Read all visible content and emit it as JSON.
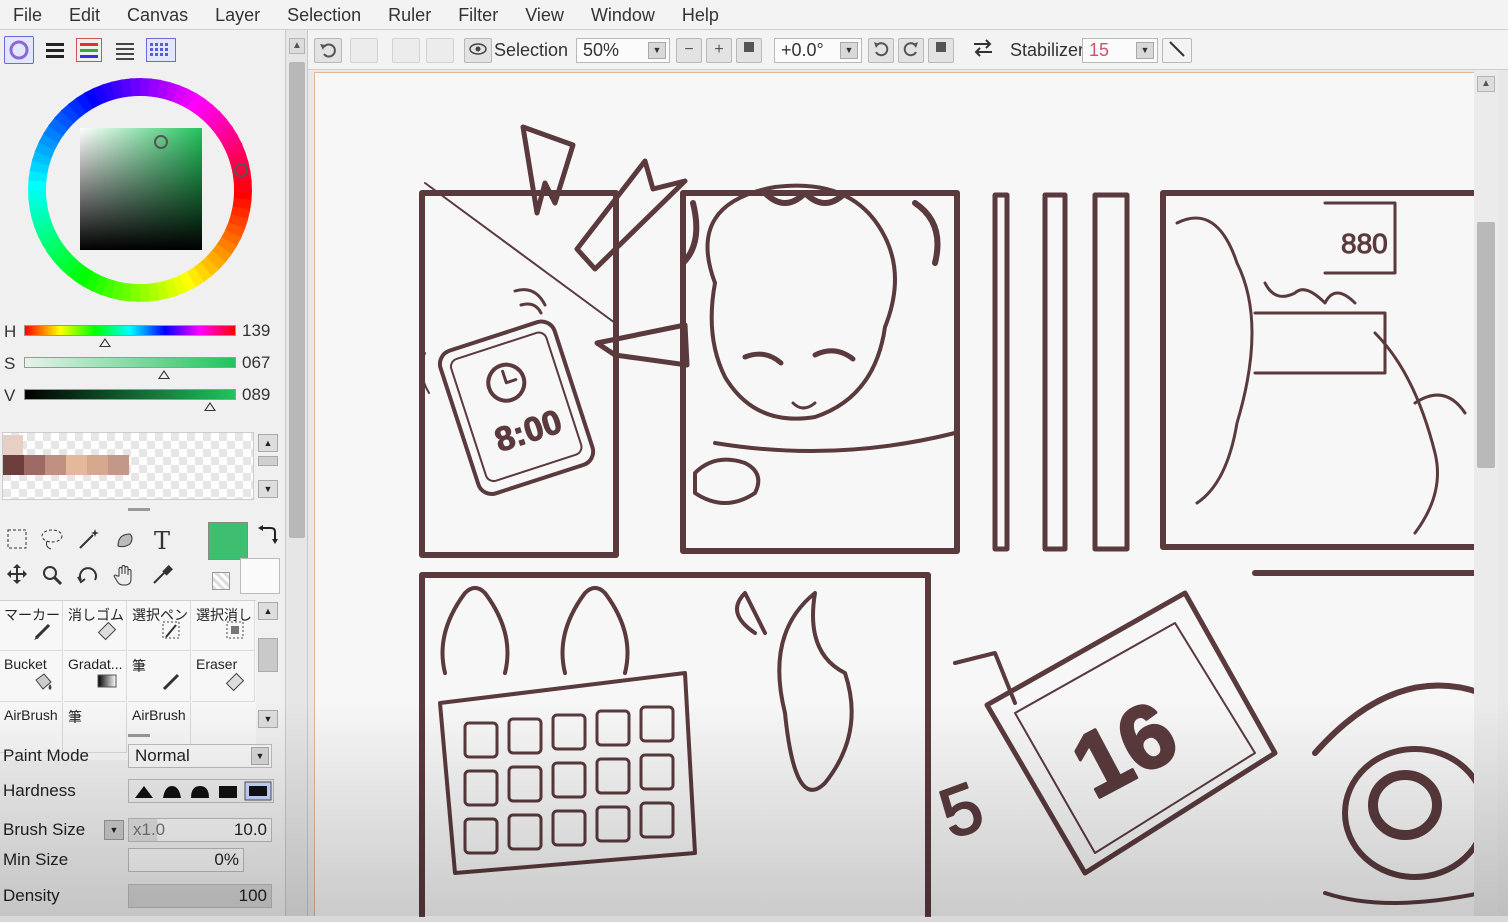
{
  "menu": [
    "File",
    "Edit",
    "Canvas",
    "Layer",
    "Selection",
    "Ruler",
    "Filter",
    "View",
    "Window",
    "Help"
  ],
  "color": {
    "current_color": "#3ebf6f",
    "h_label": "H",
    "h_value": "139",
    "s_label": "S",
    "s_value": "067",
    "v_label": "V",
    "v_value": "089",
    "h_fraction": 0.38,
    "s_fraction": 0.67,
    "v_fraction": 0.89
  },
  "swatches": [
    "#6e3e3e",
    "#9e6a66",
    "#c09080",
    "#e4b89a",
    "#d6a88e",
    "#c49888"
  ],
  "tools": [
    "select-rect-icon",
    "lasso-icon",
    "magic-wand-icon",
    "select-pen-icon",
    "text-icon",
    "move-icon",
    "zoom-icon",
    "rotate-icon",
    "hand-icon",
    "eyedropper-icon"
  ],
  "text_tool_glyph": "T",
  "brushes": [
    {
      "name": "マーカー",
      "icon": "pen-icon"
    },
    {
      "name": "消しゴム",
      "icon": "eraser-icon"
    },
    {
      "name": "選択ペン",
      "icon": "select-pen-icon"
    },
    {
      "name": "選択消し",
      "icon": "select-erase-icon"
    },
    {
      "name": "Bucket",
      "icon": "bucket-icon"
    },
    {
      "name": "Gradat...",
      "icon": "gradient-icon"
    },
    {
      "name": "筆",
      "icon": "brush-icon"
    },
    {
      "name": "Eraser",
      "icon": "eraser-icon"
    },
    {
      "name": "AirBrush",
      "icon": ""
    },
    {
      "name": "筆",
      "icon": ""
    },
    {
      "name": "AirBrush",
      "icon": ""
    }
  ],
  "props": {
    "paint_mode_label": "Paint Mode",
    "paint_mode_value": "Normal",
    "hardness_label": "Hardness",
    "brush_size_label": "Brush Size",
    "brush_size_mult": "x1.0",
    "brush_size_value": "10.0",
    "min_size_label": "Min Size",
    "min_size_value": "0%",
    "density_label": "Density",
    "density_value": "100"
  },
  "toolbar": {
    "selection_label": "Selection",
    "zoom_value": "50%",
    "rotation_value": "+0.0°",
    "stabilizer_label": "Stabilizer",
    "stabilizer_value": "15"
  },
  "canvas_text": {
    "phone_time": "8:00",
    "big_number": "16",
    "side_number": "5"
  },
  "ink_color": "#5a3a3d"
}
